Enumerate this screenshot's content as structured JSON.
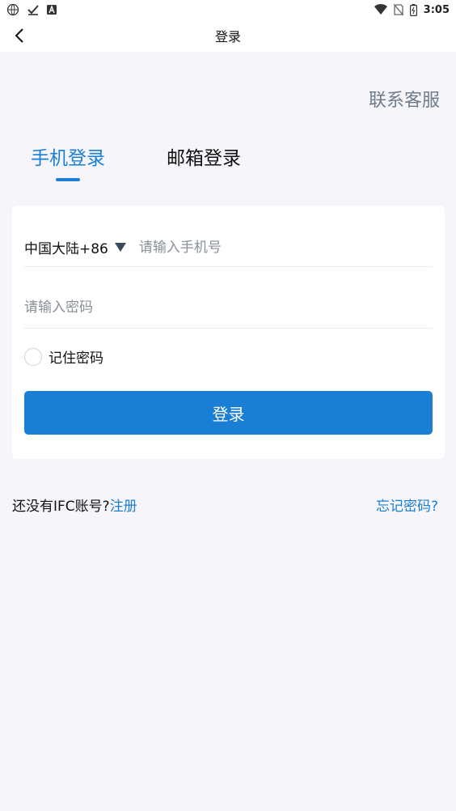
{
  "status_bar": {
    "time": "3:05",
    "icons": [
      "globe-icon",
      "check-icon",
      "font-icon",
      "wifi-icon",
      "no-sim-icon",
      "battery-icon"
    ]
  },
  "app_bar": {
    "title": "登录"
  },
  "contact": {
    "label": "联系客服"
  },
  "tabs": [
    {
      "label": "手机登录",
      "active": true
    },
    {
      "label": "邮箱登录",
      "active": false
    }
  ],
  "form": {
    "country_code": "中国大陆+86",
    "phone_placeholder": "请输入手机号",
    "password_placeholder": "请输入密码",
    "remember_label": "记住密码",
    "login_label": "登录"
  },
  "footer": {
    "no_account": "还没有IFC账号?",
    "register": "注册",
    "forgot": "忘记密码?"
  },
  "colors": {
    "accent": "#1a7fd4",
    "background": "#f5f5fa",
    "card": "#ffffff"
  }
}
